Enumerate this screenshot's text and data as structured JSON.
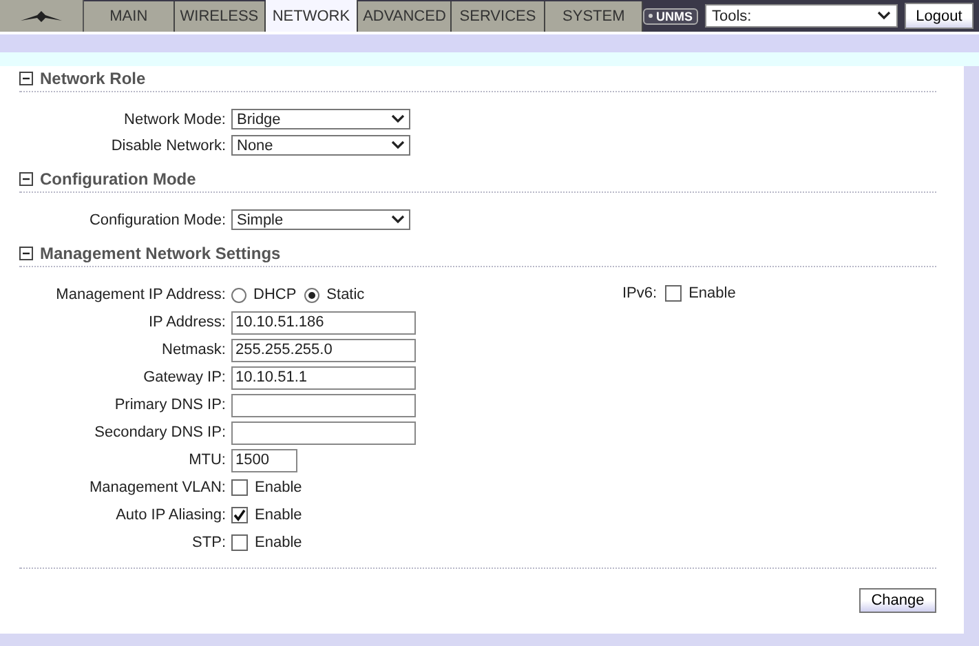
{
  "tabs": [
    {
      "label": "MAIN",
      "selected": false
    },
    {
      "label": "WIRELESS",
      "selected": false
    },
    {
      "label": "NETWORK",
      "selected": true
    },
    {
      "label": "ADVANCED",
      "selected": false
    },
    {
      "label": "SERVICES",
      "selected": false
    },
    {
      "label": "SYSTEM",
      "selected": false
    }
  ],
  "unms_badge": "UNMS",
  "tools_select": {
    "value": "Tools:"
  },
  "logout_button": "Logout",
  "sections": [
    {
      "title": "Network Role",
      "expanded": true,
      "rows": [
        {
          "kind": "select",
          "label": "Network Mode:",
          "value": "Bridge"
        },
        {
          "kind": "select",
          "label": "Disable Network:",
          "value": "None"
        }
      ]
    },
    {
      "title": "Configuration Mode",
      "expanded": true,
      "rows": [
        {
          "kind": "select",
          "label": "Configuration Mode:",
          "value": "Simple"
        }
      ]
    },
    {
      "title": "Management Network Settings",
      "expanded": true,
      "side": {
        "label": "IPv6:",
        "option": "Enable",
        "checked": false
      },
      "rows": [
        {
          "kind": "radio",
          "label": "Management IP Address:",
          "options": [
            {
              "label": "DHCP",
              "selected": false
            },
            {
              "label": "Static",
              "selected": true
            }
          ]
        },
        {
          "kind": "text",
          "label": "IP Address:",
          "value": "10.10.51.186"
        },
        {
          "kind": "text",
          "label": "Netmask:",
          "value": "255.255.255.0"
        },
        {
          "kind": "text",
          "label": "Gateway IP:",
          "value": "10.10.51.1"
        },
        {
          "kind": "text",
          "label": "Primary DNS IP:"
        },
        {
          "kind": "text",
          "label": "Secondary DNS IP:"
        },
        {
          "kind": "short_text",
          "label": "MTU:",
          "value": "1500"
        },
        {
          "kind": "checkbox",
          "label": "Management VLAN:",
          "option": "Enable",
          "checked": false
        },
        {
          "kind": "checkbox",
          "label": "Auto IP Aliasing:",
          "option": "Enable",
          "checked": true
        },
        {
          "kind": "checkbox",
          "label": "STP:",
          "option": "Enable",
          "checked": false
        }
      ]
    }
  ],
  "change_button": "Change"
}
